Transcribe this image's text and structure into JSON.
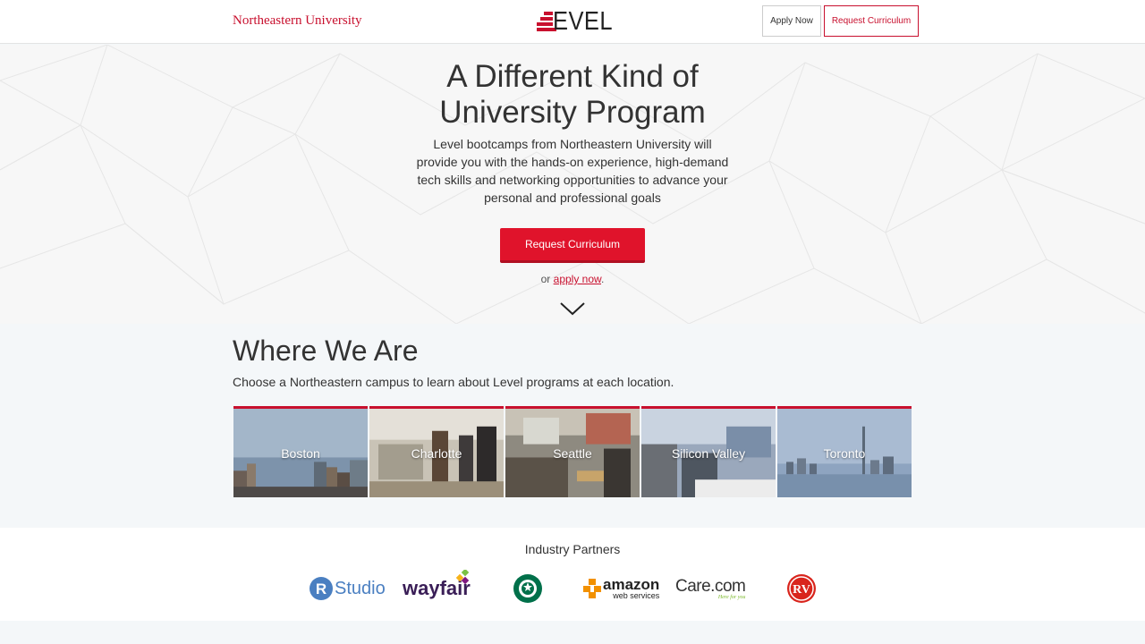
{
  "header": {
    "university": "Northeastern University",
    "brand": "EVEL",
    "apply_label": "Apply Now",
    "request_label": "Request Curriculum"
  },
  "hero": {
    "title_line1": "A Different Kind of",
    "title_line2": "University Program",
    "description": "Level bootcamps from Northeastern University will provide you with the hands-on experience, high-demand tech skills and networking opportunities to advance your personal and professional goals",
    "cta_label": "Request Curriculum",
    "or_text": "or",
    "apply_link": "apply now",
    "period": "."
  },
  "where": {
    "title": "Where We Are",
    "subtitle": "Choose a Northeastern campus to learn about Level programs at each location.",
    "locations": [
      "Boston",
      "Charlotte",
      "Seattle",
      "Silicon Valley",
      "Toronto"
    ]
  },
  "partners": {
    "title": "Industry Partners",
    "logos": [
      "rstudio-logo",
      "wayfair-logo",
      "starbucks-logo",
      "amazon-web-services-logo",
      "care-com-logo",
      "rv-logo"
    ],
    "rstudio": "Studio",
    "rstudio_r": "R",
    "wayfair": "wayfair",
    "amazon": "amazon",
    "amazon_sub": "web services",
    "care": "Care.com",
    "care_sub": "Here for you",
    "rv": "RV"
  },
  "colors": {
    "accent": "#c8102e",
    "cta": "#e0132b"
  }
}
